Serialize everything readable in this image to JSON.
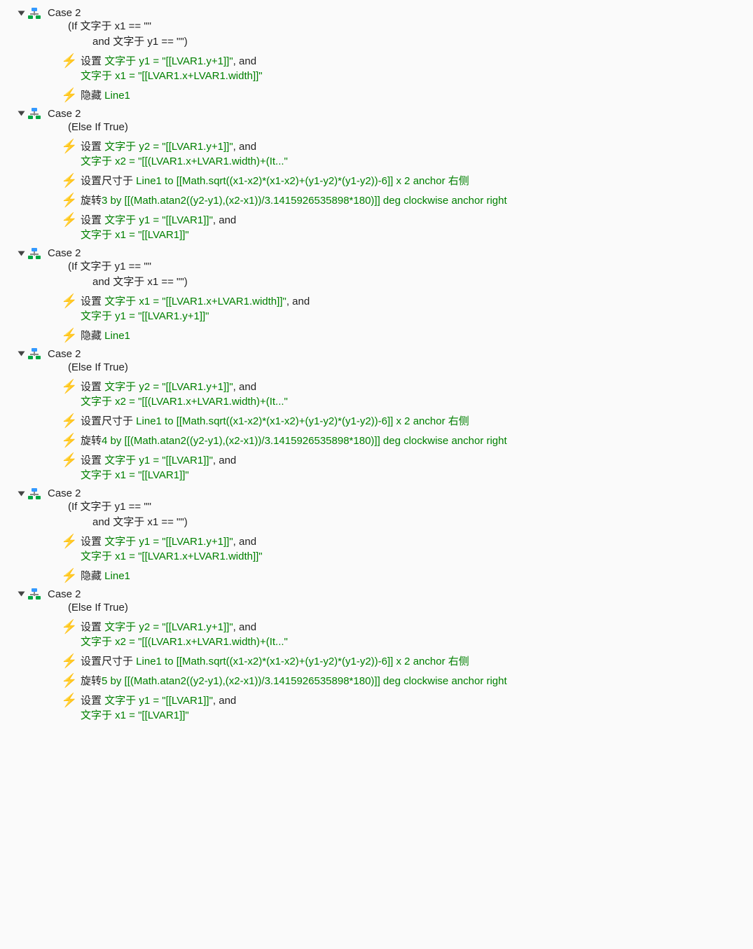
{
  "cases": [
    {
      "title": "Case 2",
      "cond1": "(If 文字于 x1 == \"\"",
      "cond2": "and 文字于 y1 == \"\")",
      "actions": [
        {
          "parts": [
            {
              "t": "设置 "
            },
            {
              "t": "文字于 y1 = \"[[LVAR1.y+1]]\"",
              "g": true
            },
            {
              "t": ", and"
            },
            {
              "br": true
            },
            {
              "t": "文字于 x1 = \"[[LVAR1.x+LVAR1.width]]\"",
              "g": true
            }
          ]
        },
        {
          "parts": [
            {
              "t": "隐藏 "
            },
            {
              "t": "Line1",
              "g": true
            }
          ]
        }
      ]
    },
    {
      "title": "Case 2",
      "cond1": "(Else If True)",
      "cond2": "",
      "actions": [
        {
          "parts": [
            {
              "t": "设置 "
            },
            {
              "t": "文字于 y2 = \"[[LVAR1.y+1]]\"",
              "g": true
            },
            {
              "t": ", and"
            },
            {
              "br": true
            },
            {
              "t": "文字于 x2 = \"[[(LVAR1.x+LVAR1.width)+(It...\"",
              "g": true
            }
          ]
        },
        {
          "parts": [
            {
              "t": "设置尺寸于 "
            },
            {
              "t": "Line1 to [[Math.sqrt((x1-x2)*(x1-x2)+(y1-y2)*(y1-y2))-6]] x 2 anchor 右侧",
              "g": true
            }
          ]
        },
        {
          "parts": [
            {
              "t": "旋转"
            },
            {
              "t": "3 by [[(Math.atan2((y2-y1),(x2-x1))/3.1415926535898*180)]] deg clockwise anchor right",
              "g": true
            }
          ]
        },
        {
          "parts": [
            {
              "t": "设置 "
            },
            {
              "t": "文字于 y1 = \"[[LVAR1]]\"",
              "g": true
            },
            {
              "t": ", and"
            },
            {
              "br": true
            },
            {
              "t": "文字于 x1 = \"[[LVAR1]]\"",
              "g": true
            }
          ]
        }
      ]
    },
    {
      "title": "Case 2",
      "cond1": "(If 文字于 y1 == \"\"",
      "cond2": "and 文字于 x1 == \"\")",
      "actions": [
        {
          "parts": [
            {
              "t": "设置 "
            },
            {
              "t": "文字于 x1 = \"[[LVAR1.x+LVAR1.width]]\"",
              "g": true
            },
            {
              "t": ", and"
            },
            {
              "br": true
            },
            {
              "t": "文字于 y1 = \"[[LVAR1.y+1]]\"",
              "g": true
            }
          ]
        },
        {
          "parts": [
            {
              "t": "隐藏 "
            },
            {
              "t": "Line1",
              "g": true
            }
          ]
        }
      ]
    },
    {
      "title": "Case 2",
      "cond1": "(Else If True)",
      "cond2": "",
      "actions": [
        {
          "parts": [
            {
              "t": "设置 "
            },
            {
              "t": "文字于 y2 = \"[[LVAR1.y+1]]\"",
              "g": true
            },
            {
              "t": ", and"
            },
            {
              "br": true
            },
            {
              "t": "文字于 x2 = \"[[(LVAR1.x+LVAR1.width)+(It...\"",
              "g": true
            }
          ]
        },
        {
          "parts": [
            {
              "t": "设置尺寸于 "
            },
            {
              "t": "Line1 to [[Math.sqrt((x1-x2)*(x1-x2)+(y1-y2)*(y1-y2))-6]] x 2 anchor 右侧",
              "g": true
            }
          ]
        },
        {
          "parts": [
            {
              "t": "旋转"
            },
            {
              "t": "4 by [[(Math.atan2((y2-y1),(x2-x1))/3.1415926535898*180)]] deg clockwise anchor right",
              "g": true
            }
          ]
        },
        {
          "parts": [
            {
              "t": "设置 "
            },
            {
              "t": "文字于 y1 = \"[[LVAR1]]\"",
              "g": true
            },
            {
              "t": ", and"
            },
            {
              "br": true
            },
            {
              "t": "文字于 x1 = \"[[LVAR1]]\"",
              "g": true
            }
          ]
        }
      ]
    },
    {
      "title": "Case 2",
      "cond1": "(If 文字于 y1 == \"\"",
      "cond2": "and 文字于 x1 == \"\")",
      "actions": [
        {
          "parts": [
            {
              "t": "设置 "
            },
            {
              "t": "文字于 y1 = \"[[LVAR1.y+1]]\"",
              "g": true
            },
            {
              "t": ", and"
            },
            {
              "br": true
            },
            {
              "t": "文字于 x1 = \"[[LVAR1.x+LVAR1.width]]\"",
              "g": true
            }
          ]
        },
        {
          "parts": [
            {
              "t": "隐藏 "
            },
            {
              "t": "Line1",
              "g": true
            }
          ]
        }
      ]
    },
    {
      "title": "Case 2",
      "cond1": "(Else If True)",
      "cond2": "",
      "actions": [
        {
          "parts": [
            {
              "t": "设置 "
            },
            {
              "t": "文字于 y2 = \"[[LVAR1.y+1]]\"",
              "g": true
            },
            {
              "t": ", and"
            },
            {
              "br": true
            },
            {
              "t": "文字于 x2 = \"[[(LVAR1.x+LVAR1.width)+(It...\"",
              "g": true
            }
          ]
        },
        {
          "parts": [
            {
              "t": "设置尺寸于 "
            },
            {
              "t": "Line1 to [[Math.sqrt((x1-x2)*(x1-x2)+(y1-y2)*(y1-y2))-6]] x 2 anchor 右侧",
              "g": true
            }
          ]
        },
        {
          "parts": [
            {
              "t": "旋转"
            },
            {
              "t": "5 by [[(Math.atan2((y2-y1),(x2-x1))/3.1415926535898*180)]] deg clockwise anchor right",
              "g": true
            }
          ]
        },
        {
          "parts": [
            {
              "t": "设置 "
            },
            {
              "t": "文字于 y1 = \"[[LVAR1]]\"",
              "g": true
            },
            {
              "t": ", and"
            },
            {
              "br": true
            },
            {
              "t": "文字于 x1 = \"[[LVAR1]]\"",
              "g": true
            }
          ]
        }
      ]
    }
  ]
}
